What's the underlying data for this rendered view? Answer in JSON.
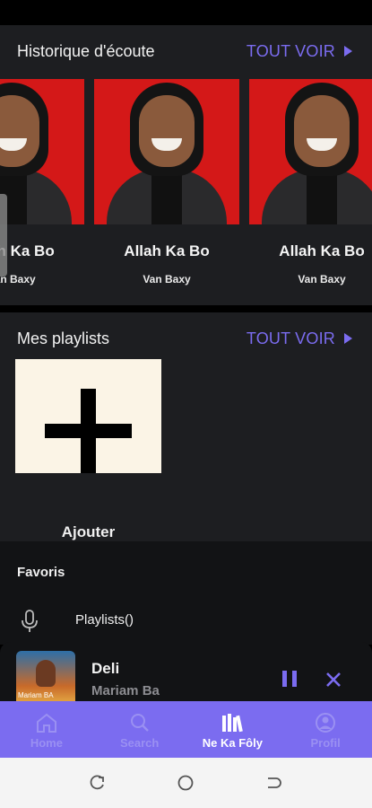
{
  "history": {
    "title": "Historique d'écoute",
    "see_all": "TOUT VOIR",
    "tracks": [
      {
        "title": "Allah Ka Bo",
        "artist": "Van Baxy"
      },
      {
        "title": "Allah Ka Bo",
        "artist": "Van Baxy"
      },
      {
        "title": "Allah Ka Bo",
        "artist": "Van Baxy"
      }
    ]
  },
  "playlists": {
    "title": "Mes playlists",
    "see_all": "TOUT VOIR",
    "add_label": "Ajouter"
  },
  "favoris": {
    "title": "Favoris",
    "item_label": "Playlists()"
  },
  "player": {
    "title": "Deli",
    "artist": "Mariam Ba",
    "art_text": "Mariam BA"
  },
  "bottom_nav": {
    "items": [
      {
        "label": "Home",
        "icon": "home-icon",
        "active": false
      },
      {
        "label": "Search",
        "icon": "search-icon",
        "active": false
      },
      {
        "label": "Ne Ka Fôly",
        "icon": "library-icon",
        "active": true
      },
      {
        "label": "Profil",
        "icon": "profile-icon",
        "active": false
      }
    ]
  },
  "colors": {
    "accent": "#7b6cf0",
    "surface": "#1d1e21",
    "cover_red": "#d41818"
  }
}
